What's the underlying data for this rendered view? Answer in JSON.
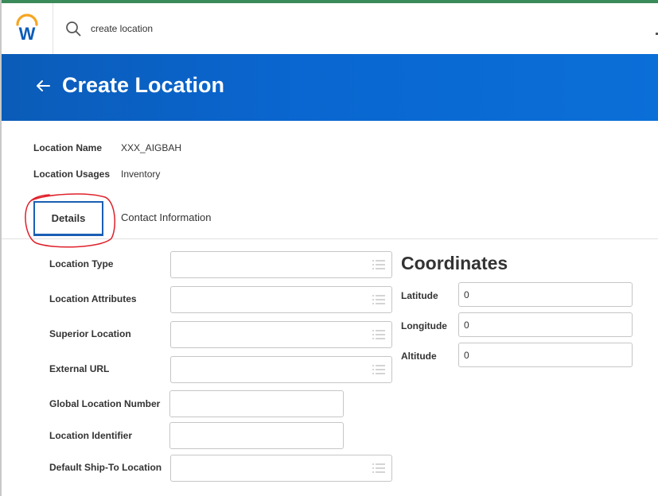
{
  "header": {
    "logo_letter": "W",
    "search": {
      "value": "create location"
    }
  },
  "banner": {
    "title": "Create Location"
  },
  "summary": {
    "location_name_label": "Location Name",
    "location_name_value": "XXX_AIGBAH",
    "location_usages_label": "Location Usages",
    "location_usages_value": "Inventory"
  },
  "tabs": [
    {
      "label": "Details",
      "active": true
    },
    {
      "label": "Contact Information",
      "active": false
    }
  ],
  "details": {
    "fields": [
      {
        "label": "Location Type"
      },
      {
        "label": "Location Attributes"
      },
      {
        "label": "Superior Location"
      },
      {
        "label": "External URL"
      },
      {
        "label": "Global Location Number"
      },
      {
        "label": "Location Identifier"
      },
      {
        "label": "Default Ship-To Location"
      }
    ]
  },
  "coordinates": {
    "title": "Coordinates",
    "latitude": {
      "label": "Latitude",
      "value": "0"
    },
    "longitude": {
      "label": "Longitude",
      "value": "0"
    },
    "altitude": {
      "label": "Altitude",
      "value": "0"
    }
  },
  "colors": {
    "banner": "#0a66d0",
    "tab_border": "#1a5fb4",
    "annotation": "#e0202a",
    "logo_arc": "#f5a623",
    "logo_letter": "#0b5cb8"
  }
}
